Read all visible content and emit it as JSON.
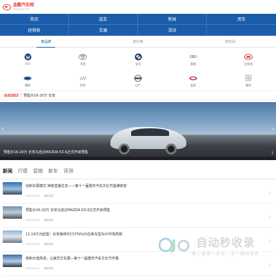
{
  "header": {
    "logo_text": "金鹏汽车网",
    "logo_sub": "chebiquan.com"
  },
  "nav": {
    "items": [
      "首页",
      "选车",
      "新闻",
      "用车",
      "经销商",
      "车展",
      "活动",
      ""
    ]
  },
  "brand_tabs": [
    "按品牌",
    "按价格",
    "按级别"
  ],
  "brands": [
    {
      "name": "大众",
      "icon": "volkswagen-logo",
      "color": "#1b3f7a"
    },
    {
      "name": "丰田",
      "icon": "toyota-logo",
      "color": "#888888"
    },
    {
      "name": "宝马",
      "icon": "bmw-logo",
      "color": "#1c4f9c"
    },
    {
      "name": "奥迪",
      "icon": "audi-logo",
      "color": "#888888"
    },
    {
      "name": "比亚迪",
      "icon": "byd-logo",
      "color": "#cc2229"
    },
    {
      "name": "福特",
      "icon": "ford-logo",
      "color": "#1b3f7a"
    },
    {
      "name": "别克",
      "icon": "buick-logo",
      "color": "#999999"
    },
    {
      "name": "日产",
      "icon": "nissan-logo",
      "color": "#555555"
    },
    {
      "name": "起亚",
      "icon": "kia-logo",
      "color": "#c2242a"
    },
    {
      "name": "更多",
      "icon": "more-icon",
      "color": "#999999"
    }
  ],
  "ad": {
    "tag": "马自达EZ",
    "text": "预售价16-20万 长安"
  },
  "slider": {
    "caption": "预售价16-20万 长安马自达MAZDA EZ-6正式开启预售",
    "counter": "1"
  },
  "news_tabs": [
    "新闻",
    "行情",
    "促销",
    "新车",
    "评测"
  ],
  "news": [
    {
      "title": "创新车展模式 焕新直播生态——第十一届重庆汽车文化节圆满收官",
      "date": "2024-06-24",
      "author": "锦和根霞",
      "thumb": "linear-gradient(180deg,#2f6fb0,#9cc2e0 55%,#3a4a5a)"
    },
    {
      "title": "预售价16-20万 长安马自达MAZDA EZ-6正式开启预售",
      "date": "2024-06-23",
      "author": "锦和根霞",
      "thumb": "linear-gradient(180deg,#6f8fae,#c0ccd6 50%,#4d5560)"
    },
    {
      "title": "12.19万元起售！长安第四代CS75PLUS在新车型SUV市场亮相",
      "date": "2024-06-22",
      "author": "锦和根霞",
      "thumb": "linear-gradient(180deg,#8fb4d8,#dfe7ee 50%,#6d7680)"
    },
    {
      "title": "南新价值高涨，让差异文化展—第十一届重庆汽车文化节开幕",
      "date": "2024-06-21",
      "author": "锦和根霞",
      "thumb": "linear-gradient(180deg,#3c6fa7,#b7cde2 55%,#2f3a46)"
    }
  ],
  "watermark": {
    "title": "自动秒收录",
    "sub": "做上排得一来访一次一相同排名"
  }
}
